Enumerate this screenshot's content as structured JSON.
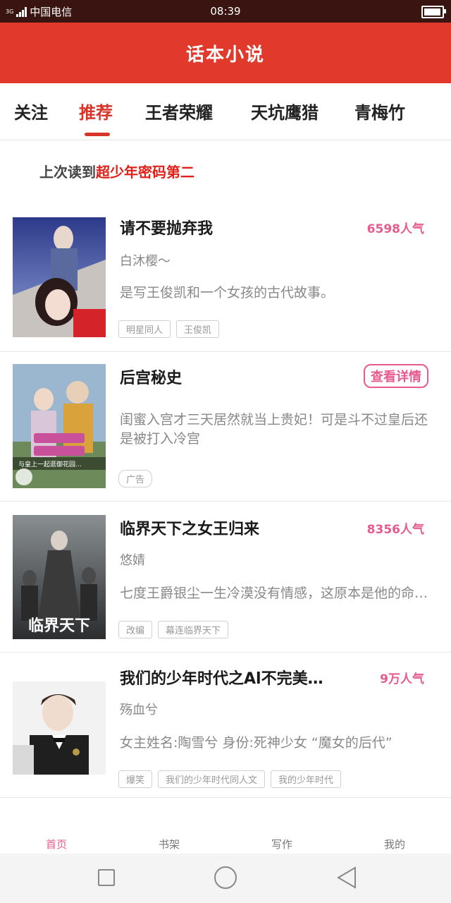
{
  "status_bar": {
    "network": "3G",
    "carrier": "中国电信",
    "time": "08:39",
    "battery_level": 0.95
  },
  "app": {
    "title": "话本小说"
  },
  "tabs": [
    {
      "label": "关注"
    },
    {
      "label": "推荐"
    },
    {
      "label": "王者荣耀"
    },
    {
      "label": "天坑鹰猎"
    },
    {
      "label": "青梅竹"
    }
  ],
  "active_tab": "推荐",
  "last_read": {
    "prefix": "上次读到",
    "book": "超少年密码第二"
  },
  "feed": [
    {
      "title": "请不要抛弃我",
      "popularity": "6598人气",
      "author": "白沐樱～",
      "description": "是写王俊凯和一个女孩的古代故事。",
      "tags": [
        "明星同人",
        "王俊凯"
      ]
    },
    {
      "title": "后宫秘史",
      "action": "查看详情",
      "description": "闺蜜入宫才三天居然就当上贵妃！可是斗不过皇后还是被打入冷宫",
      "tags": [
        "广告"
      ],
      "cover_caption": "与皇上一起逛御花园…"
    },
    {
      "title": "临界天下之女王归来",
      "popularity": "8356人气",
      "author": "悠婧",
      "description": "七度王爵银尘一生冷漠没有情感，这原本是他的命运，",
      "tags": [
        "改编",
        "幕连临界天下"
      ],
      "cover_text": "临界天下"
    },
    {
      "title": "我们的少年时代之Al不完美…",
      "popularity": "9万人气",
      "author": "殇血兮",
      "description": "女主姓名:陶雪兮 身份:死神少女 “魔女的后代”",
      "tags": [
        "爆笑",
        "我们的少年时代同人文",
        "我的少年时代"
      ]
    }
  ],
  "bottom_nav": [
    {
      "label": "首页"
    },
    {
      "label": "书架"
    },
    {
      "label": "写作"
    },
    {
      "label": "我的"
    }
  ],
  "active_nav": "首页",
  "colors": {
    "brand": "#e13a2c",
    "accent": "#e75a8e",
    "status_bar": "#3a1410"
  },
  "icons": [
    "signal-icon",
    "battery-icon",
    "home-square-icon",
    "home-circle-icon",
    "back-triangle-icon"
  ]
}
